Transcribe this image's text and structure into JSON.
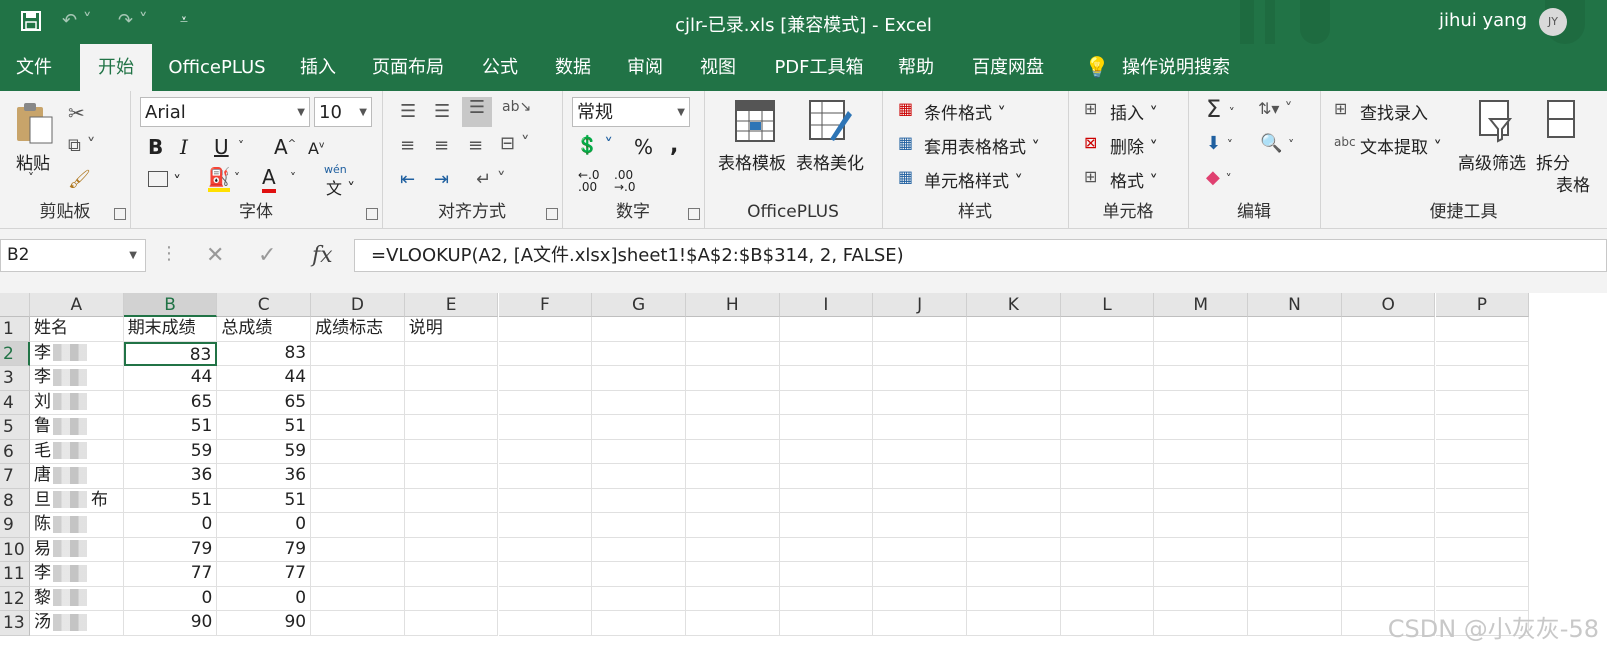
{
  "titlebar": {
    "title": "cjlr-已录.xls  [兼容模式]  -  Excel",
    "user": "jihui yang",
    "avatar_initials": "JY",
    "icons": [
      "save-icon",
      "undo-icon",
      "redo-icon",
      "customize-icon"
    ]
  },
  "tabs": [
    "文件",
    "开始",
    "OfficePLUS",
    "插入",
    "页面布局",
    "公式",
    "数据",
    "审阅",
    "视图",
    "PDF工具箱",
    "帮助",
    "百度网盘",
    "操作说明搜索"
  ],
  "active_tab": "开始",
  "ribbon": {
    "clipboard": {
      "label": "剪贴板",
      "paste": "粘贴"
    },
    "font": {
      "label": "字体",
      "name": "Arial",
      "size": "10",
      "bold": "B",
      "italic": "I",
      "underline": "U",
      "wen": "wén"
    },
    "align": {
      "label": "对齐方式"
    },
    "number": {
      "label": "数字",
      "format": "常规",
      "percent": "%",
      "comma": ","
    },
    "officeplus": {
      "label": "OfficePLUS",
      "template": "表格模板",
      "beautify": "表格美化"
    },
    "styles": {
      "label": "样式",
      "cond": "条件格式",
      "table": "套用表格格式",
      "cell": "单元格样式"
    },
    "cells": {
      "label": "单元格",
      "insert": "插入",
      "delete": "删除",
      "format": "格式"
    },
    "edit": {
      "label": "编辑"
    },
    "quick": {
      "label": "便捷工具",
      "find": "查找录入",
      "extract": "文本提取",
      "filter": "高级筛选",
      "split": "拆分",
      "split2": "表格"
    }
  },
  "formula_bar": {
    "name_box": "B2",
    "formula": "=VLOOKUP(A2, [A文件.xlsx]sheet1!$A$2:$B$314, 2, FALSE)"
  },
  "sheet": {
    "columns": [
      "A",
      "B",
      "C",
      "D",
      "E",
      "F",
      "G",
      "H",
      "I",
      "J",
      "K",
      "L",
      "M",
      "N",
      "O",
      "P"
    ],
    "header_row": [
      "姓名",
      "期末成绩",
      "总成绩",
      "成绩标志",
      "说明"
    ],
    "rows": [
      {
        "n": "2",
        "name": "李",
        "tail": "",
        "b": "83",
        "c": "83"
      },
      {
        "n": "3",
        "name": "李",
        "tail": "",
        "b": "44",
        "c": "44"
      },
      {
        "n": "4",
        "name": "刘",
        "tail": "",
        "b": "65",
        "c": "65"
      },
      {
        "n": "5",
        "name": "鲁",
        "tail": "",
        "b": "51",
        "c": "51"
      },
      {
        "n": "6",
        "name": "毛",
        "tail": "",
        "b": "59",
        "c": "59"
      },
      {
        "n": "7",
        "name": "唐",
        "tail": "",
        "b": "36",
        "c": "36"
      },
      {
        "n": "8",
        "name": "旦",
        "tail": "布",
        "b": "51",
        "c": "51"
      },
      {
        "n": "9",
        "name": "陈",
        "tail": "",
        "b": "0",
        "c": "0"
      },
      {
        "n": "10",
        "name": "易",
        "tail": "",
        "b": "79",
        "c": "79"
      },
      {
        "n": "11",
        "name": "李",
        "tail": "",
        "b": "77",
        "c": "77"
      },
      {
        "n": "12",
        "name": "黎",
        "tail": "",
        "b": "0",
        "c": "0"
      },
      {
        "n": "13",
        "name": "汤",
        "tail": "",
        "b": "90",
        "c": "90"
      }
    ],
    "active_cell": "B2"
  },
  "watermark": "CSDN @小灰灰-58",
  "colors": {
    "accent": "#217346",
    "ribbon": "#f3f3f3"
  }
}
